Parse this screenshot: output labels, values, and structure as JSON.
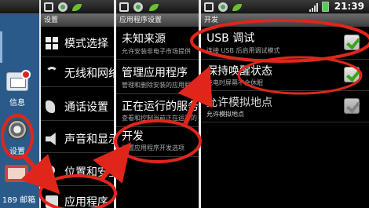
{
  "status": {
    "time": "21:39"
  },
  "home": {
    "apps": [
      {
        "label": "信息"
      },
      {
        "label": "设置"
      },
      {
        "label": "189 邮箱"
      }
    ]
  },
  "settings": {
    "title": "设置",
    "items": [
      {
        "label": "模式选择",
        "icon": "grid-icon"
      },
      {
        "label": "无线和网络",
        "icon": "wifi-icon"
      },
      {
        "label": "通话设置",
        "icon": "phone-icon"
      },
      {
        "label": "声音和显示",
        "icon": "speaker-icon"
      },
      {
        "label": "位置和安全",
        "icon": "location-icon"
      },
      {
        "label": "应用程序",
        "icon": "apps-icon"
      }
    ]
  },
  "app_settings": {
    "title": "应用程序设置",
    "items": [
      {
        "label": "未知来源",
        "sub": "允许安装非电子市场提供"
      },
      {
        "label": "管理应用程序",
        "sub": "管理和删除安装的应用程序"
      },
      {
        "label": "正在运行的服务",
        "sub": "查看和控制当前正在运行的"
      },
      {
        "label": "开发",
        "sub": "设置应用程序开发选项"
      }
    ]
  },
  "development": {
    "title": "开发",
    "items": [
      {
        "label": "USB 调试",
        "sub": "连接 USB 后启用调试模式",
        "checked": true
      },
      {
        "label": "保持唤醒状态",
        "sub": "充电时屏幕不会休眠",
        "checked": true
      },
      {
        "label": "允许模拟地点",
        "sub": "允许模拟地点",
        "checked": false
      }
    ]
  },
  "colors": {
    "annotation": "#e0261b",
    "checkmark": "#3aa51c"
  }
}
